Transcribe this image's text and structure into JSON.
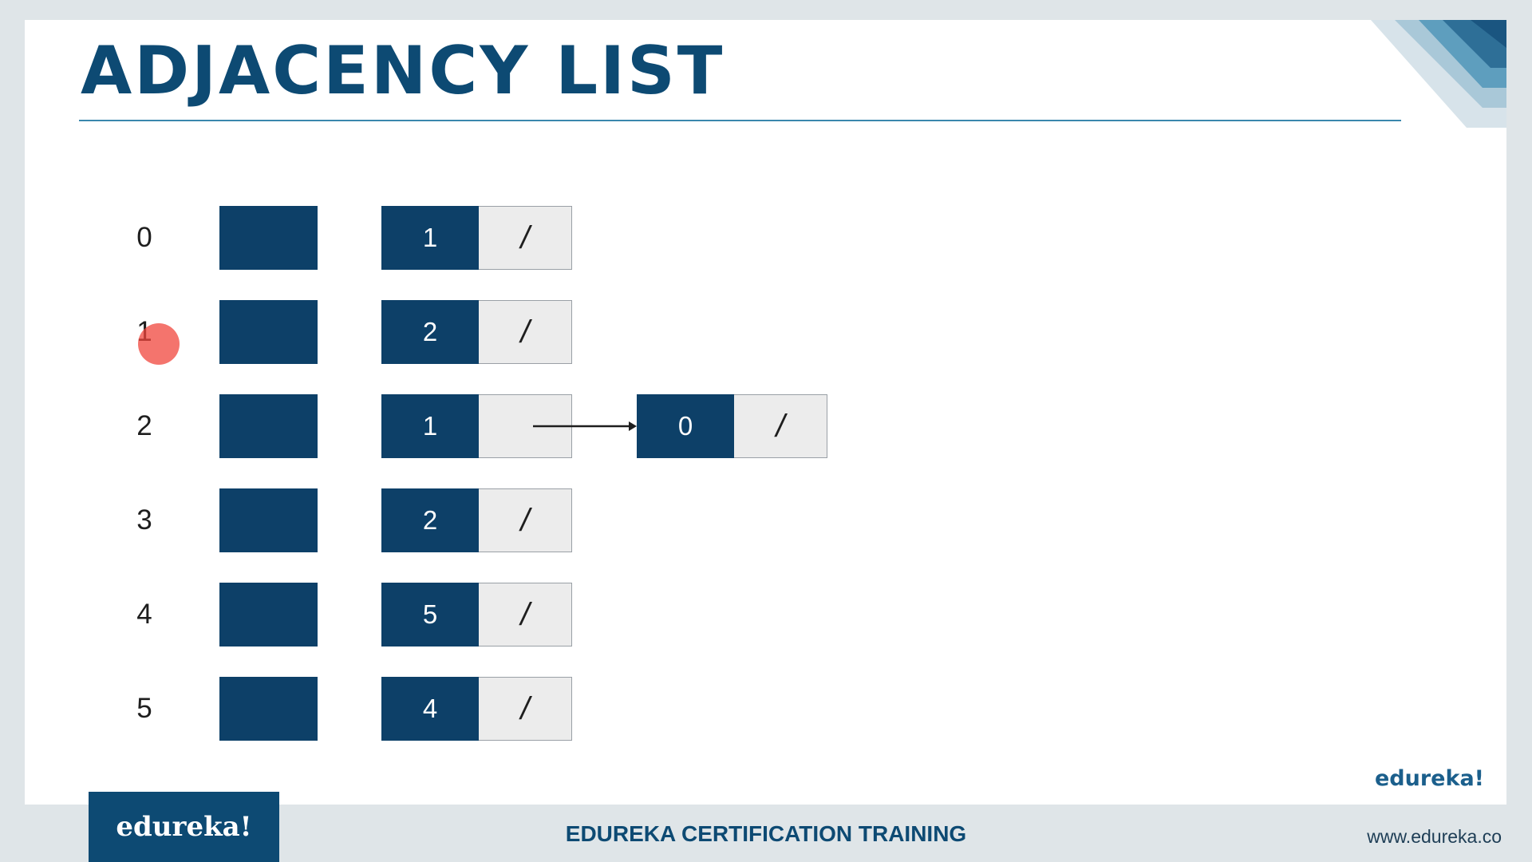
{
  "title": "ADJACENCY LIST",
  "colors": {
    "title": "#0d4a73",
    "box_fill": "#0d4068",
    "pointer_cell": "#ececec",
    "rule": "#3a87ad"
  },
  "rows": [
    {
      "index": "0",
      "nodes": [
        {
          "value": "1",
          "next": "/"
        }
      ]
    },
    {
      "index": "1",
      "nodes": [
        {
          "value": "2",
          "next": "/"
        }
      ]
    },
    {
      "index": "2",
      "nodes": [
        {
          "value": "1",
          "next": ""
        },
        {
          "value": "0",
          "next": "/"
        }
      ]
    },
    {
      "index": "3",
      "nodes": [
        {
          "value": "2",
          "next": "/"
        }
      ]
    },
    {
      "index": "4",
      "nodes": [
        {
          "value": "5",
          "next": "/"
        }
      ]
    },
    {
      "index": "5",
      "nodes": [
        {
          "value": "4",
          "next": "/"
        }
      ]
    }
  ],
  "slide_logo": "edureka!",
  "footer": {
    "logo": "edureka!",
    "center_text": "EDUREKA CERTIFICATION TRAINING",
    "url": "www.edureka.co"
  }
}
